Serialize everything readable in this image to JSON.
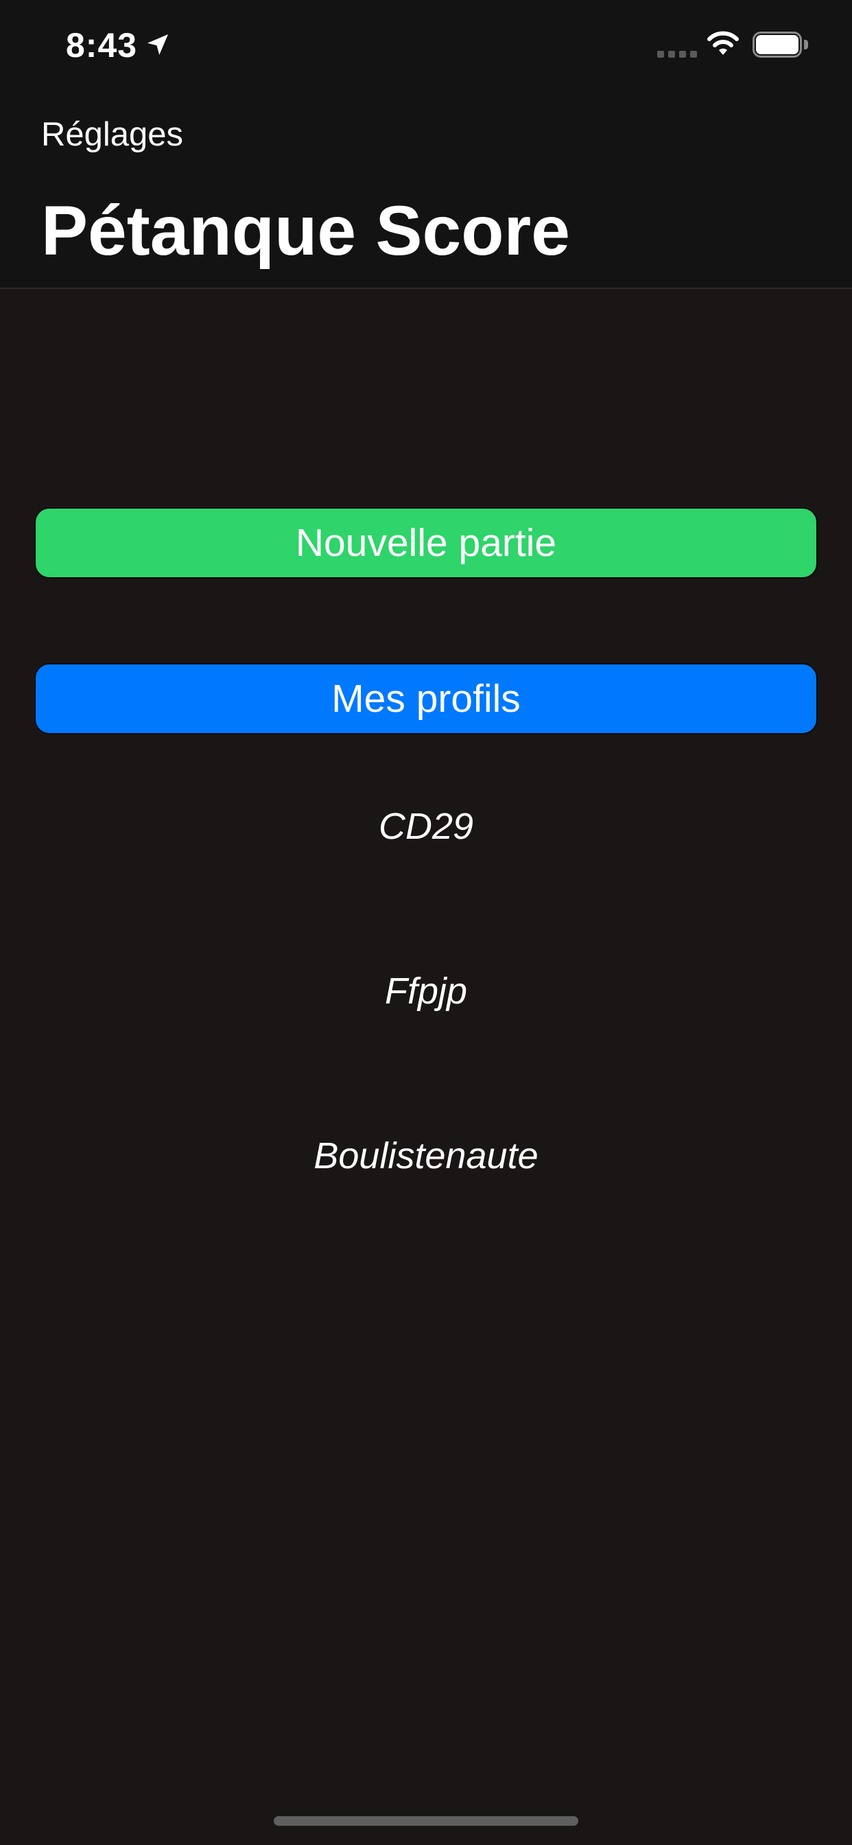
{
  "status_bar": {
    "time": "8:43",
    "location_icon": "location-arrow-icon",
    "signal_icon": "cellular-signal-icon",
    "wifi_icon": "wifi-icon",
    "battery_icon": "battery-icon"
  },
  "nav": {
    "back_label": "Réglages",
    "title": "Pétanque Score"
  },
  "actions": {
    "new_game_label": "Nouvelle partie",
    "profiles_label": "Mes profils"
  },
  "profiles": [
    {
      "label": "CD29"
    },
    {
      "label": "Ffpjp"
    },
    {
      "label": "Boulistenaute"
    }
  ],
  "colors": {
    "background": "#1a1616",
    "header_background": "#131313",
    "new_game_button": "#2fd46a",
    "profiles_button": "#0079ff",
    "text": "#ffffff"
  }
}
